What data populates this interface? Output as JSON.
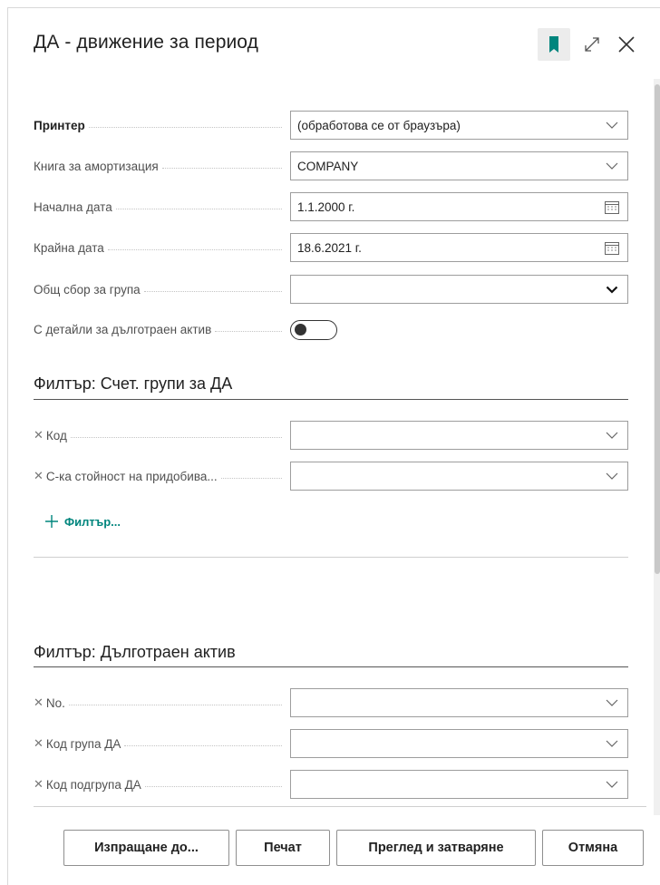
{
  "dialog": {
    "title": "ДА - движение за период",
    "header_icons": [
      "bookmark-icon",
      "expand-icon",
      "close-icon"
    ]
  },
  "options": [
    {
      "label": "Принтер",
      "value": "(обработова се от браузъра)",
      "control": "dropdown",
      "bold": true
    },
    {
      "label": "Книга за амортизация",
      "value": "COMPANY",
      "control": "dropdown"
    },
    {
      "label": "Начална дата",
      "value": "1.1.2000 г.",
      "control": "date"
    },
    {
      "label": "Крайна дата",
      "value": "18.6.2021 г.",
      "control": "date"
    },
    {
      "label": "Общ сбор за група",
      "value": "",
      "control": "select"
    },
    {
      "label": "С детайли за дълготраен актив",
      "toggle_on": false,
      "control": "toggle"
    }
  ],
  "filter_groups": {
    "title": "Филтър: Счет. групи за ДА",
    "fields": [
      {
        "label": "Код",
        "value": ""
      },
      {
        "label": "С-ка стойност на придобива...",
        "value": ""
      }
    ],
    "add_filter_label": "Филтър..."
  },
  "filter_assets": {
    "title": "Филтър: Дълготраен актив",
    "fields": [
      {
        "label": "No.",
        "value": ""
      },
      {
        "label": "Код група ДА",
        "value": ""
      },
      {
        "label": "Код подгрупа ДА",
        "value": ""
      }
    ]
  },
  "footer": {
    "send_to": "Изпращане до...",
    "print": "Печат",
    "preview_close": "Преглед и затваряне",
    "cancel": "Отмяна"
  },
  "colors": {
    "accent": "#00857d",
    "border": "#9d9d9d",
    "text": "#212121",
    "label": "#505050"
  }
}
